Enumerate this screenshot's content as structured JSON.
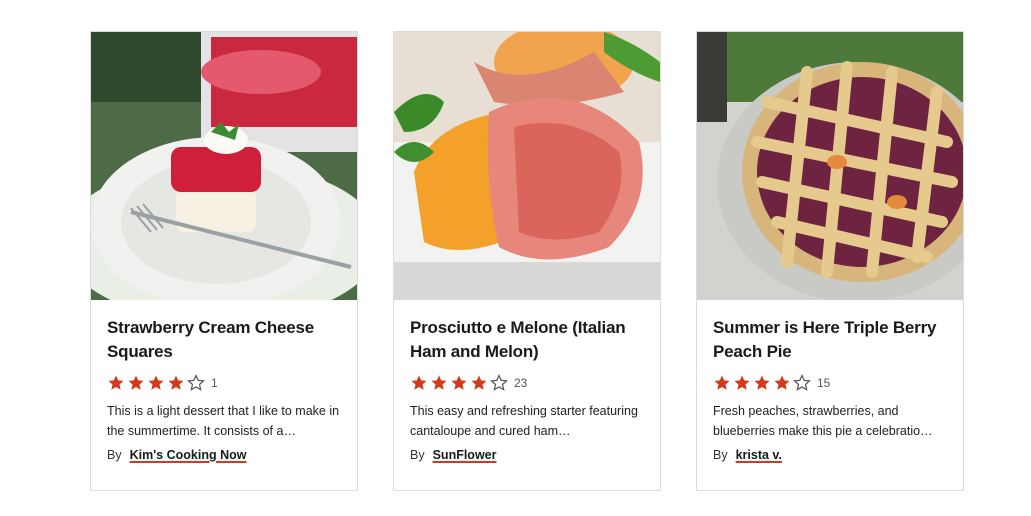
{
  "colors": {
    "star_filled": "#d33a1b",
    "star_empty": "#555555",
    "link_underline": "#d33a1b"
  },
  "cards": [
    {
      "title": "Strawberry Cream Cheese Squares",
      "rating": 4,
      "max_rating": 5,
      "review_count": "1",
      "description": "This is a light dessert that I like to make in the summertime. It consists of a…",
      "by_label": "By",
      "author": "Kim's Cooking Now"
    },
    {
      "title": "Prosciutto e Melone (Italian Ham and Melon)",
      "rating": 4,
      "max_rating": 5,
      "review_count": "23",
      "description": "This easy and refreshing starter featuring cantaloupe and cured ham…",
      "by_label": "By",
      "author": "SunFlower"
    },
    {
      "title": "Summer is Here Triple Berry Peach Pie",
      "rating": 4,
      "max_rating": 5,
      "review_count": "15",
      "description": "Fresh peaches, strawberries, and blueberries make this pie a celebratio…",
      "by_label": "By",
      "author": "krista v."
    }
  ]
}
